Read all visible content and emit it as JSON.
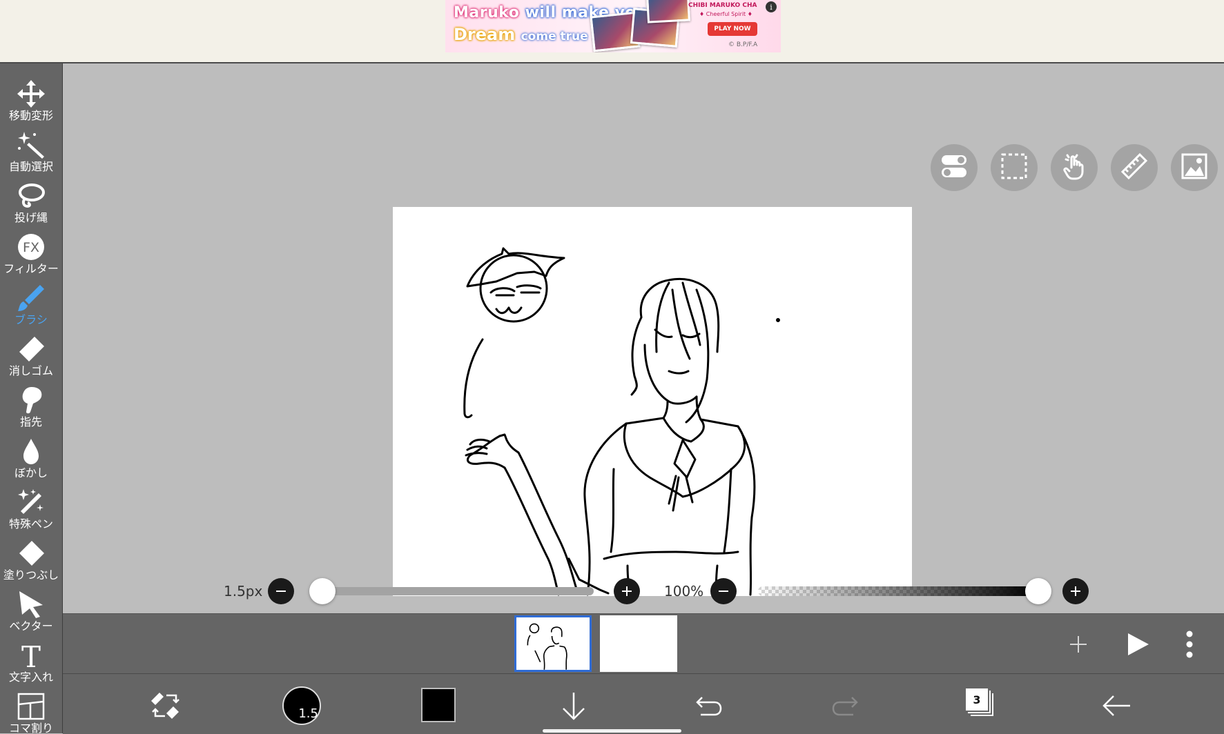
{
  "ad": {
    "line1_a": "Maruko",
    "line1_b": "will",
    "line1_c": "make your",
    "line2_a": "Dream",
    "line2_b": "come true !",
    "title": "CHIBI MARUKO CHA",
    "subtitle": "♦ Cheerful Spirit ♦",
    "cta": "PLAY NOW",
    "copyright": "© B.P/F.A",
    "info": "i"
  },
  "tools": [
    {
      "label": "移動変形",
      "icon": "move-transform-icon",
      "active": false
    },
    {
      "label": "自動選択",
      "icon": "magic-wand-icon",
      "active": false
    },
    {
      "label": "投げ縄",
      "icon": "lasso-icon",
      "active": false
    },
    {
      "label": "フィルター",
      "icon": "fx-filter-icon",
      "active": false
    },
    {
      "label": "ブラシ",
      "icon": "brush-icon",
      "active": true
    },
    {
      "label": "消しゴム",
      "icon": "eraser-icon",
      "active": false
    },
    {
      "label": "指先",
      "icon": "finger-smudge-icon",
      "active": false
    },
    {
      "label": "ぼかし",
      "icon": "blur-drop-icon",
      "active": false
    },
    {
      "label": "特殊ペン",
      "icon": "special-pen-icon",
      "active": false
    },
    {
      "label": "塗りつぶし",
      "icon": "fill-bucket-icon",
      "active": false
    },
    {
      "label": "ベクター",
      "icon": "vector-arrow-icon",
      "active": false
    },
    {
      "label": "文字入れ",
      "icon": "text-icon",
      "active": false
    },
    {
      "label": "コマ割り",
      "icon": "panel-divide-icon",
      "active": false
    }
  ],
  "sliders": {
    "brush_size_label": "1.5px",
    "brush_size_fraction": 0.0,
    "opacity_label": "100%",
    "opacity_fraction": 1.0
  },
  "bottom": {
    "brush_size_value": "1.5",
    "color": "#000000",
    "layers_count": "3"
  },
  "colors": {
    "accent": "#4aa3f0",
    "selected_frame": "#2f6cd6",
    "toolbar_bg": "#656565",
    "workspace_bg": "#bdbdbd"
  }
}
